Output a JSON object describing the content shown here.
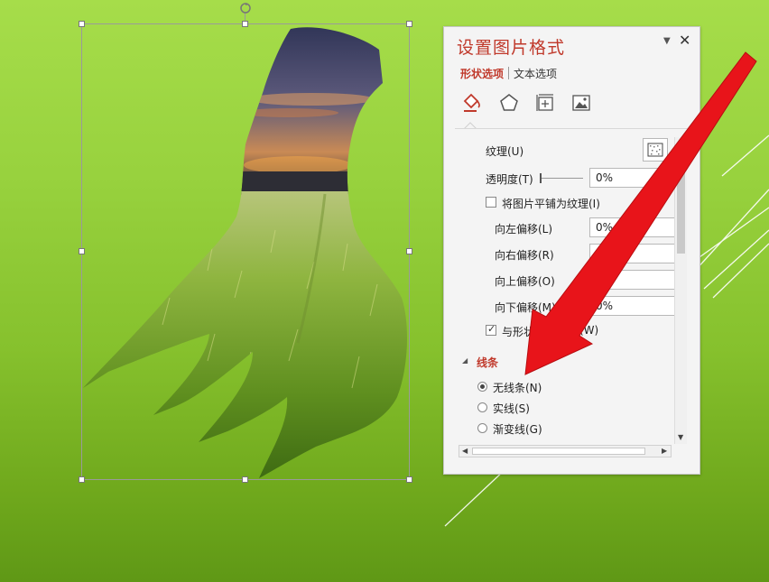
{
  "slide": {
    "background_color": "#8cc63f",
    "picture_description_colors": {
      "sky": "#4a4668",
      "grass": "#7fae2c"
    }
  },
  "format_pane": {
    "title": "设置图片格式",
    "tabs": [
      {
        "label": "形状选项",
        "active": true
      },
      {
        "label": "文本选项",
        "active": false
      }
    ],
    "category_icons": [
      "fill-line-icon",
      "effects-pentagon-icon",
      "size-properties-icon",
      "picture-icon"
    ],
    "fill": {
      "texture_label": "纹理(U)",
      "transparency_label": "透明度(T)",
      "transparency_value": "0%",
      "tile_label": "将图片平铺为纹理(I)",
      "tile_checked": false,
      "offset_left_label": "向左偏移(L)",
      "offset_left_value": "0%",
      "offset_right_label": "向右偏移(R)",
      "offset_right_value": "0%",
      "offset_up_label": "向上偏移(O)",
      "offset_up_value": "0%",
      "offset_down_label": "向下偏移(M)",
      "offset_down_value": "0%",
      "rotate_with_shape_label_start": "与形状",
      "rotate_with_shape_label_end": "(W)",
      "rotate_with_shape_checked": true
    },
    "line_section": {
      "header": "线条",
      "options": [
        {
          "label": "无线条(N)",
          "selected": true
        },
        {
          "label": "实线(S)",
          "selected": false
        },
        {
          "label": "渐变线(G)",
          "selected": false
        }
      ]
    }
  },
  "annotation": {
    "arrow_color": "#e8141a"
  }
}
